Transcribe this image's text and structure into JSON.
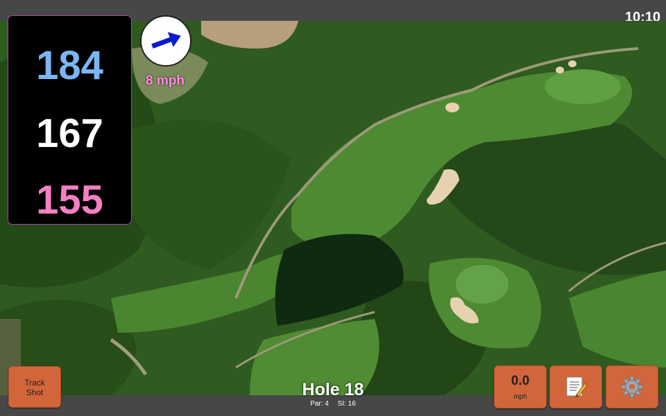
{
  "status": {
    "time": "10:10"
  },
  "yardages": {
    "back": "184",
    "middle": "167",
    "front": "155"
  },
  "wind": {
    "speed": "8 mph",
    "direction_icon": "arrow-icon"
  },
  "buttons": {
    "track_line1": "Track",
    "track_line2": "Shot",
    "speed_value": "0.0",
    "speed_unit": "mph",
    "notes_icon": "notepad-icon",
    "settings_icon": "gear-icon"
  },
  "hole": {
    "title": "Hole 18",
    "par": "Par: 4",
    "si": "SI: 16"
  },
  "colors": {
    "back": "#7bb6f3",
    "middle": "#ffffff",
    "front": "#f57fc3",
    "button": "#d2663a",
    "bar": "#474747"
  }
}
